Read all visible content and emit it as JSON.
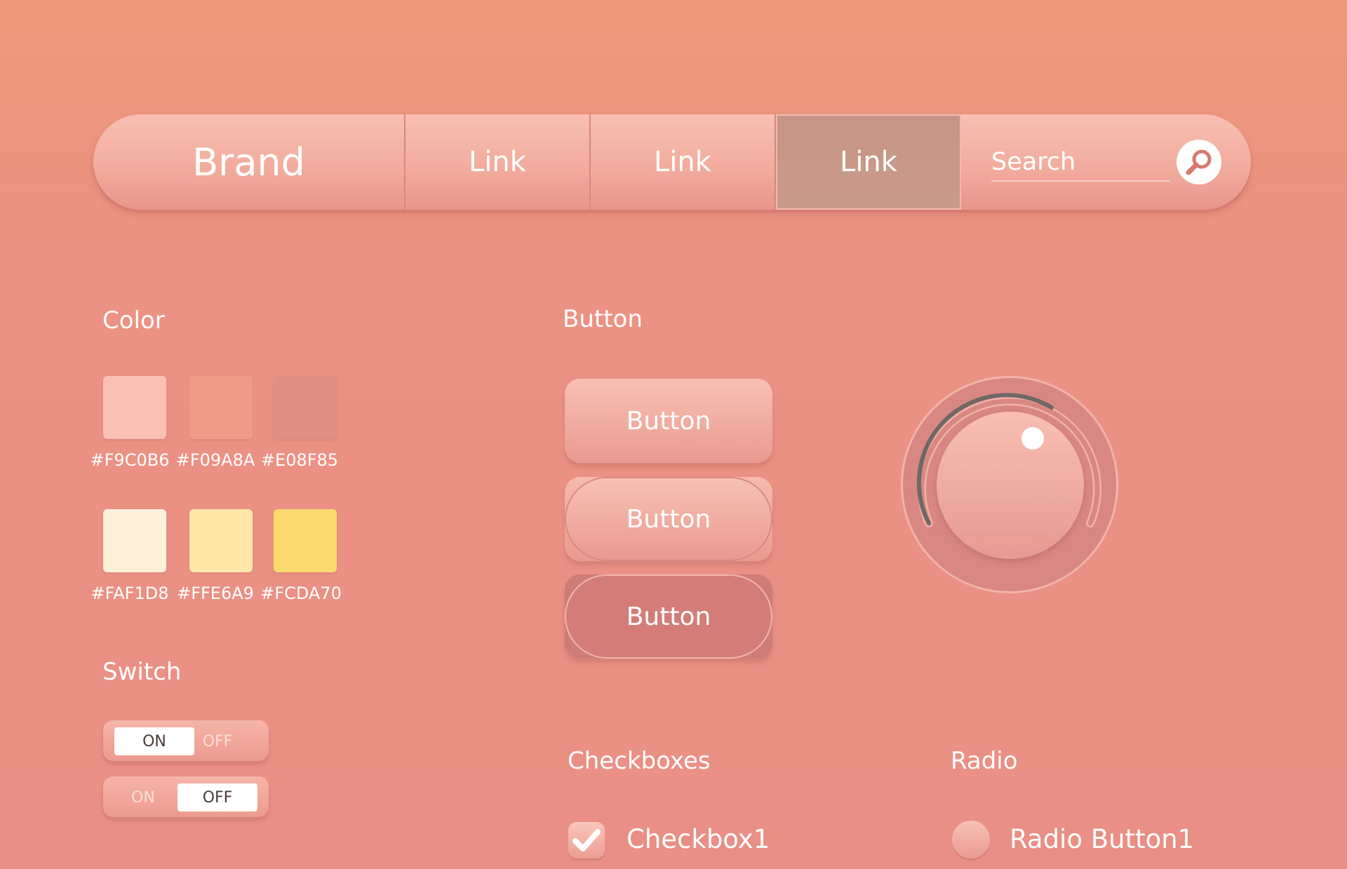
{
  "navbar": {
    "brand": "Brand",
    "links": [
      "Link",
      "Link",
      "Link"
    ],
    "active_link_index": 2,
    "search_placeholder": "Search",
    "search_icon": "magnifier-icon"
  },
  "sections": {
    "color": "Color",
    "button": "Button",
    "switch": "Switch",
    "checkboxes": "Checkboxes",
    "radio": "Radio"
  },
  "colors": [
    {
      "hex": "#F9C0B6",
      "label": "#F9C0B6"
    },
    {
      "hex": "#F09A8A",
      "label": "#F09A8A"
    },
    {
      "hex": "#E08F85",
      "label": "#E08F85"
    },
    {
      "hex": "#FAF1D8",
      "label": "#FAF1D8"
    },
    {
      "hex": "#FFE6A9",
      "label": "#FFE6A9"
    },
    {
      "hex": "#FCDA70",
      "label": "#FCDA70"
    }
  ],
  "switches": [
    {
      "on": "ON",
      "off": "OFF",
      "state": "ON"
    },
    {
      "on": "ON",
      "off": "OFF",
      "state": "OFF"
    }
  ],
  "buttons": [
    "Button",
    "Button",
    "Button"
  ],
  "checkbox": {
    "label": "Checkbox1",
    "checked": true
  },
  "radio": {
    "label": "Radio Button1",
    "selected": false
  }
}
